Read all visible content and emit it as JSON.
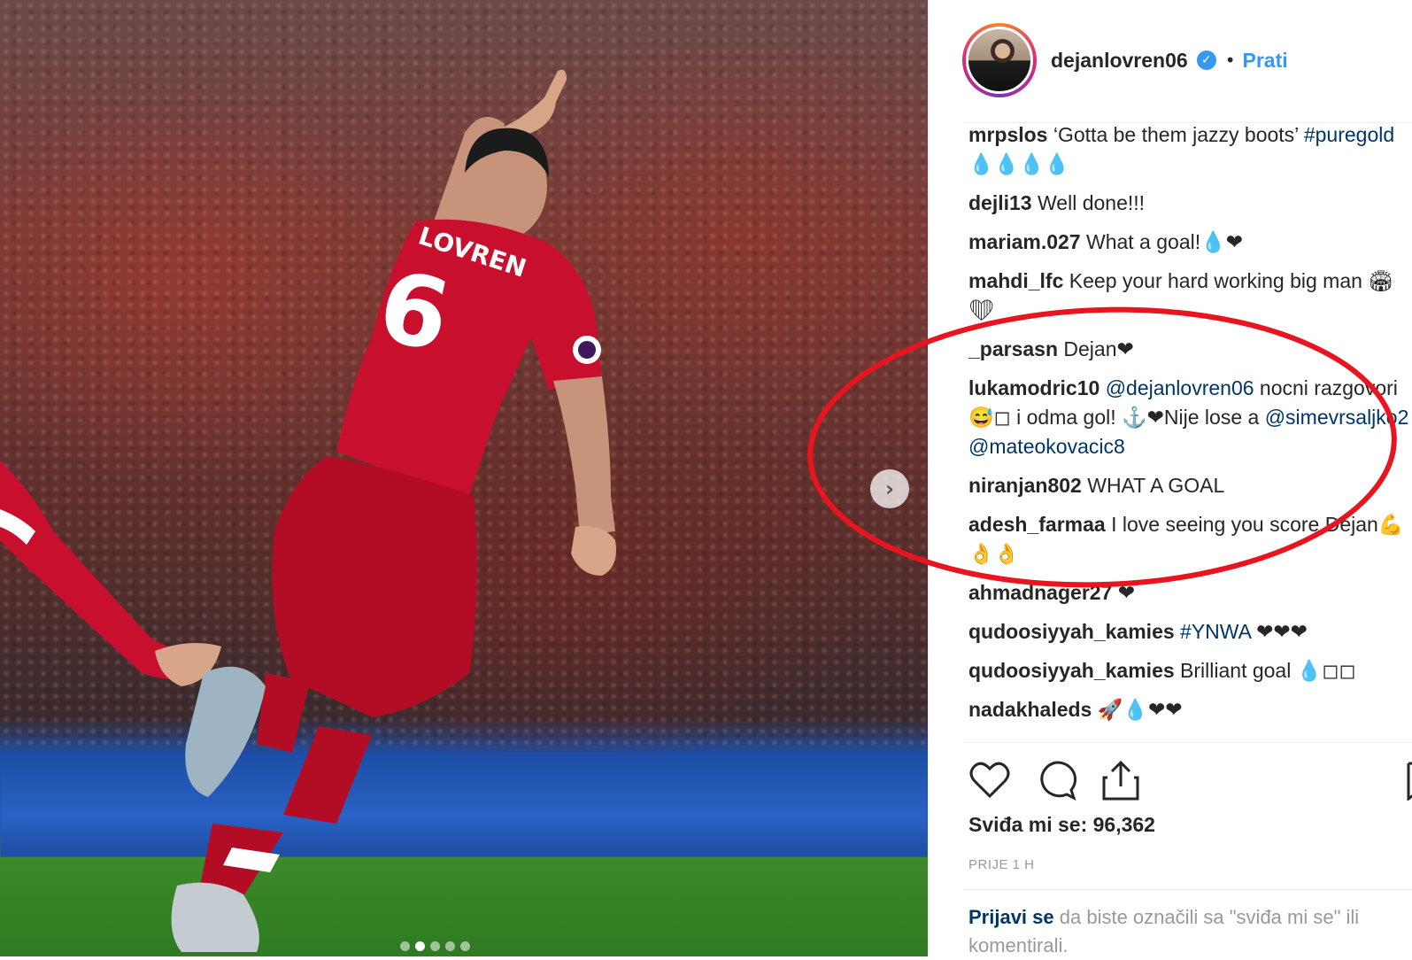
{
  "post": {
    "username": "dejanlovren06",
    "follow_label": "Prati",
    "separator": "•"
  },
  "photo": {
    "jersey_name": "LOVREN",
    "jersey_number": "6",
    "carousel_dots": 5,
    "active_dot": 2
  },
  "comments": [
    {
      "user": "mrpslos",
      "text": "‘Gotta be them jazzy boots’",
      "tag": "#puregold",
      "after": " 💧💧💧💧"
    },
    {
      "user": "dejli13",
      "text": "Well done!!!"
    },
    {
      "user": "mariam.027",
      "text": "What a goal!💧❤"
    },
    {
      "user": "mahdi_lfc",
      "text": "Keep your hard working big man 🏟❤"
    },
    {
      "user": "_parsasn",
      "text": "Dejan❤"
    },
    {
      "user": "lukamodric10",
      "mention1": "@dejanlovren06",
      "text": " nocni razgovori😅◻ i odma gol! ⚓❤Nije lose a ",
      "mention2": "@simevrsaljko2",
      "mention3": "@mateokovacic8"
    },
    {
      "user": "niranjan802",
      "text": "WHAT A GOAL"
    },
    {
      "user": "adesh_farmaa",
      "text": "I love seeing you score Dejan💪👌👌"
    },
    {
      "user": "ahmadnager27",
      "text": "❤"
    },
    {
      "user": "qudoosiyyah_kamies",
      "tag": "#YNWA",
      "after": " ❤❤❤"
    },
    {
      "user": "qudoosiyyah_kamies",
      "text": "Brilliant goal 💧◻◻"
    },
    {
      "user": "nadakhaleds",
      "text": "🚀💧❤❤"
    }
  ],
  "likes_label": "Sviđa mi se: 96,362",
  "time_label": "PRIJE 1 H",
  "login": {
    "link": "Prijavi se",
    "text": " da biste označili sa \"sviđa mi se\" ili komentirali."
  },
  "icons": [
    "heart-icon",
    "comment-icon",
    "share-icon",
    "bookmark-icon",
    "verified-icon",
    "chevron-right-icon"
  ],
  "colors": {
    "link_blue": "#3897f0",
    "mention_blue": "#003569",
    "annotation_red": "#e8141f",
    "jersey_red": "#c8102e"
  }
}
